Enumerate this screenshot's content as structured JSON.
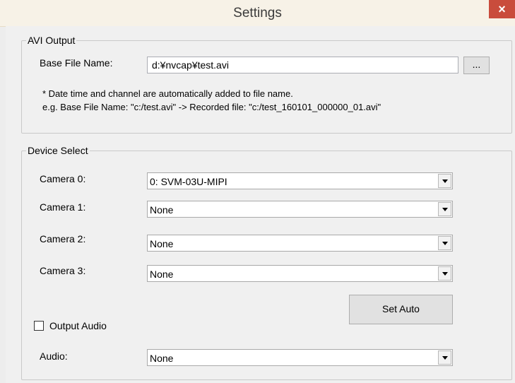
{
  "window": {
    "title": "Settings",
    "close_glyph": "×"
  },
  "avi_output": {
    "group_title": "AVI Output",
    "base_file_label": "Base File Name:",
    "base_file_value": "d:¥nvcap¥test.avi",
    "browse_label": "...",
    "note_line1": "* Date time and channel are automatically added to file name.",
    "note_line2": "e.g. Base File Name: \"c:/test.avi\" -> Recorded file: \"c:/test_160101_000000_01.avi\""
  },
  "device_select": {
    "group_title": "Device Select",
    "cameras": [
      {
        "label": "Camera 0:",
        "value": "0: SVM-03U-MIPI"
      },
      {
        "label": "Camera 1:",
        "value": "None"
      },
      {
        "label": "Camera 2:",
        "value": "None"
      },
      {
        "label": "Camera 3:",
        "value": "None"
      }
    ],
    "set_auto_label": "Set Auto",
    "output_audio_label": "Output Audio",
    "output_audio_checked": false,
    "audio_label": "Audio:",
    "audio_value": "None"
  },
  "icons": {
    "close": "close-icon",
    "dropdown": "chevron-down-icon"
  }
}
